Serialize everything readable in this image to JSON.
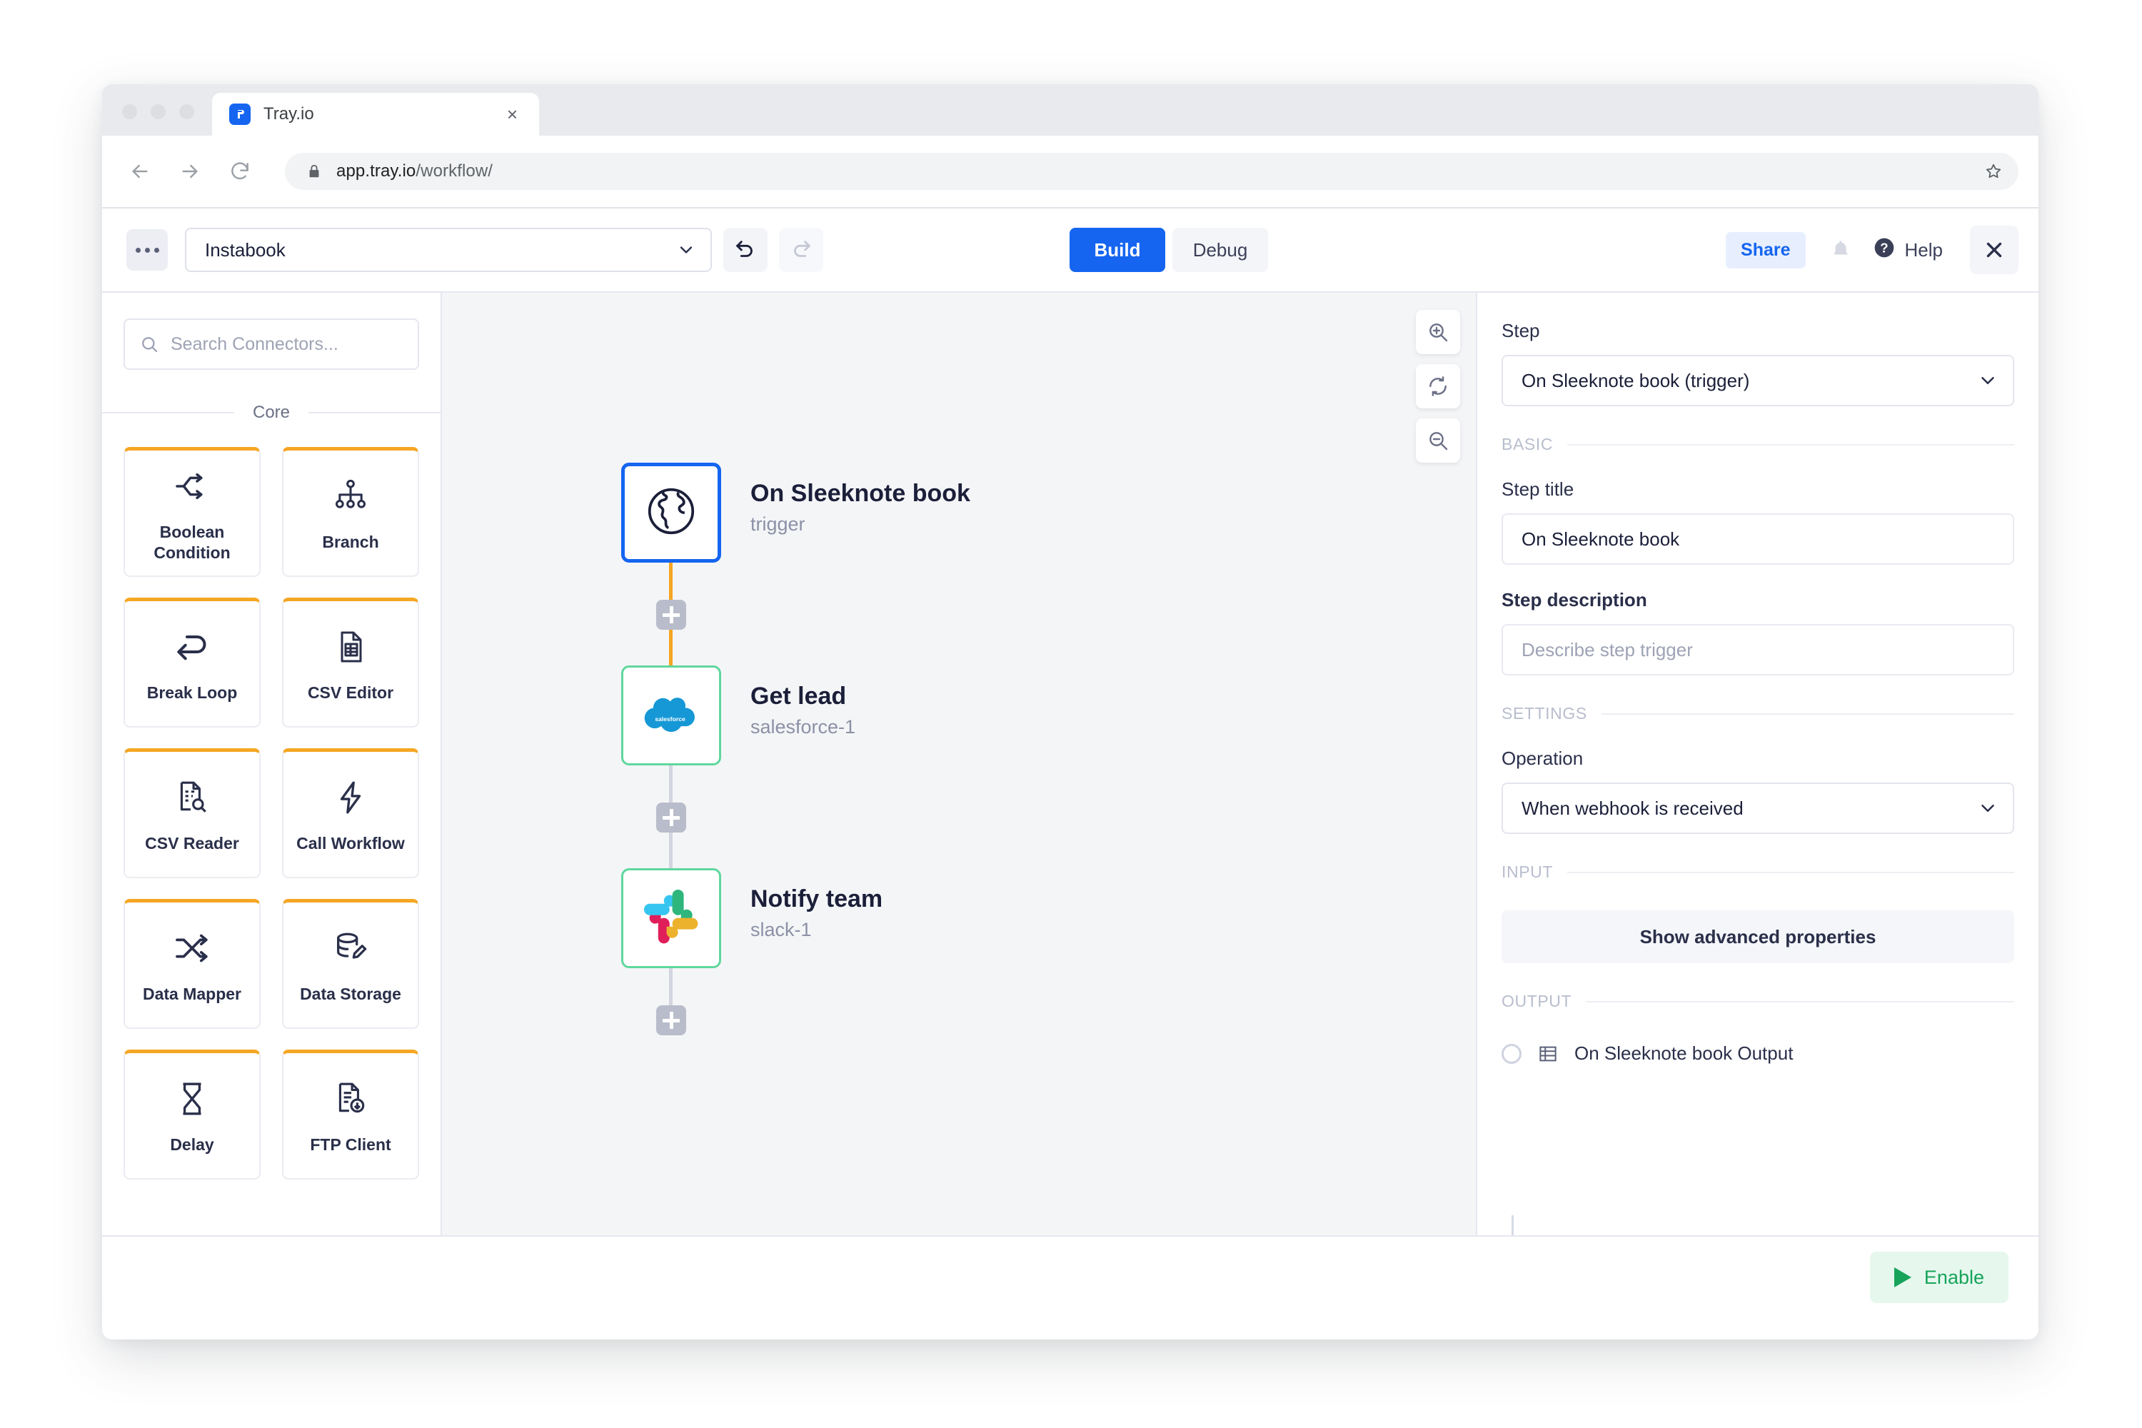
{
  "browser": {
    "tab_title": "Tray.io",
    "favicon": "tray-logo-icon",
    "close_tab": "×",
    "url_host": "app.tray.io",
    "url_path": "/workflow/",
    "back_icon": "back-arrow-icon",
    "forward_icon": "forward-arrow-icon",
    "reload_icon": "reload-icon",
    "lock_icon": "lock-icon",
    "star_icon": "bookmark-star-icon"
  },
  "toolbar": {
    "menu_icon": "kebab-menu-icon",
    "workflow_name": "Instabook",
    "workflow_caret": "chevron-down-icon",
    "undo_icon": "undo-icon",
    "redo_icon": "redo-icon",
    "build_label": "Build",
    "debug_label": "Debug",
    "share_label": "Share",
    "bell_icon": "notification-bell-icon",
    "help_label": "Help",
    "help_icon": "question-circle-icon",
    "close_icon": "close-x-icon",
    "accent_blue": "#1565f0",
    "share_blue": "#e7efff"
  },
  "sidebar": {
    "search_placeholder": "Search Connectors...",
    "search_icon": "search-icon",
    "section_label": "Core",
    "connectors": [
      {
        "label": "Boolean Condition",
        "icon": "split-arrows-icon"
      },
      {
        "label": "Branch",
        "icon": "branch-tree-icon"
      },
      {
        "label": "Break Loop",
        "icon": "loop-back-arrow-icon"
      },
      {
        "label": "CSV Editor",
        "icon": "document-table-icon"
      },
      {
        "label": "CSV Reader",
        "icon": "document-search-icon"
      },
      {
        "label": "Call Workflow",
        "icon": "lightning-bolt-icon"
      },
      {
        "label": "Data Mapper",
        "icon": "shuffle-arrows-icon"
      },
      {
        "label": "Data Storage",
        "icon": "database-pencil-icon"
      },
      {
        "label": "Delay",
        "icon": "hourglass-icon"
      },
      {
        "label": "FTP Client",
        "icon": "document-download-icon"
      }
    ],
    "card_accent": "#f5a623"
  },
  "canvas": {
    "zoom_in_icon": "zoom-in-icon",
    "fit_icon": "refresh-fit-icon",
    "zoom_out_icon": "zoom-out-icon",
    "add_step_icon": "plus-icon",
    "nodes": [
      {
        "title": "On Sleeknote book",
        "subtitle": "trigger",
        "icon": "globe-icon",
        "border": "#1565f0"
      },
      {
        "title": "Get lead",
        "subtitle": "salesforce-1",
        "icon": "salesforce-cloud-icon",
        "border": "#5fd79d"
      },
      {
        "title": "Notify team",
        "subtitle": "slack-1",
        "icon": "slack-icon",
        "border": "#5fd79d"
      }
    ],
    "edge_active_color": "#f5a623",
    "edge_idle_color": "#d3d5df"
  },
  "panel": {
    "step_label": "Step",
    "step_value": "On Sleeknote book (trigger)",
    "step_caret": "chevron-down-icon",
    "basic_section": "BASIC",
    "step_title_label": "Step title",
    "step_title_value": "On Sleeknote book",
    "step_description_label": "Step description",
    "step_description_placeholder": "Describe step trigger",
    "settings_section": "SETTINGS",
    "operation_label": "Operation",
    "operation_value": "When webhook is received",
    "operation_caret": "chevron-down-icon",
    "input_section": "INPUT",
    "advanced_button": "Show advanced properties",
    "output_section": "OUTPUT",
    "output_item": "On Sleeknote book Output",
    "output_radio": "output-radio",
    "output_icon": "table-icon"
  },
  "footer": {
    "enable_label": "Enable",
    "enable_icon": "play-triangle-icon",
    "enable_color": "#17a45a"
  }
}
